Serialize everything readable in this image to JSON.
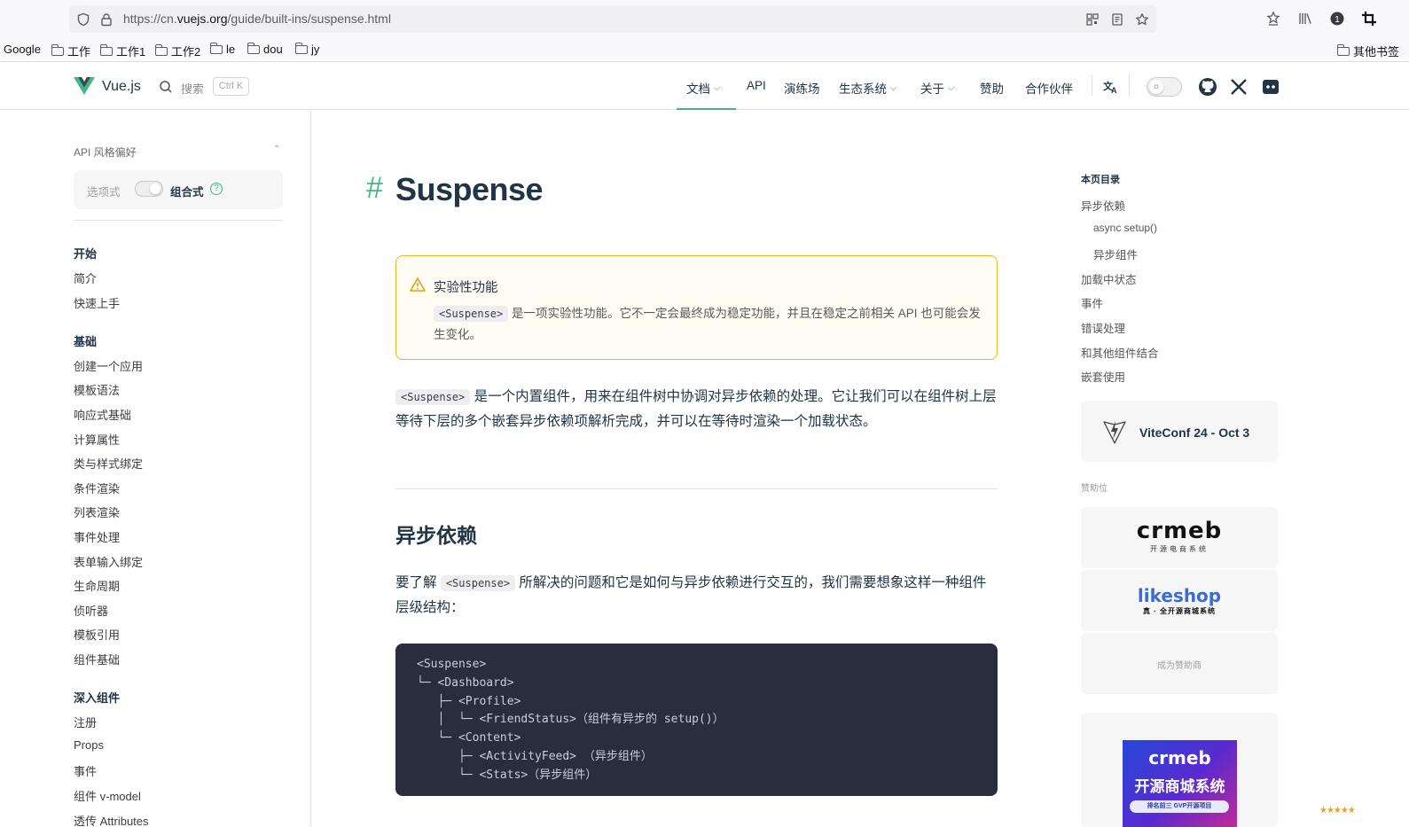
{
  "browser": {
    "url_prefix": "https://cn.",
    "url_domain": "vuejs.org",
    "url_path": "/guide/built-ins/suspense.html",
    "bookmarks": [
      "Google",
      "工作",
      "工作1",
      "工作2",
      "le",
      "dou",
      "jy"
    ],
    "other_bookmarks": "其他书签",
    "badge_count": "1"
  },
  "header": {
    "logo_text": "Vue.js",
    "search_label": "搜索",
    "search_shortcut": "Ctrl K",
    "nav": [
      {
        "label": "文档",
        "dropdown": true
      },
      {
        "label": "API"
      },
      {
        "label": "演练场"
      },
      {
        "label": "生态系统",
        "dropdown": true
      },
      {
        "label": "关于",
        "dropdown": true
      },
      {
        "label": "赞助"
      },
      {
        "label": "合作伙伴"
      }
    ],
    "accent_color": "#42b883"
  },
  "sidebar": {
    "api_pref_title": "API 风格偏好",
    "option_api": "选项式",
    "composition_api": "组合式",
    "groups": [
      {
        "title": "开始",
        "items": [
          "简介",
          "快速上手"
        ]
      },
      {
        "title": "基础",
        "items": [
          "创建一个应用",
          "模板语法",
          "响应式基础",
          "计算属性",
          "类与样式绑定",
          "条件渲染",
          "列表渲染",
          "事件处理",
          "表单输入绑定",
          "生命周期",
          "侦听器",
          "模板引用",
          "组件基础"
        ]
      },
      {
        "title": "深入组件",
        "items": [
          "注册",
          "Props",
          "事件",
          "组件 v-model",
          "透传 Attributes"
        ]
      }
    ]
  },
  "main": {
    "title": "Suspense",
    "hash": "#",
    "warning": {
      "title": "实验性功能",
      "code": "<Suspense>",
      "text": "是一项实验性功能。它不一定会最终成为稳定功能，并且在稳定之前相关 API 也可能会发生变化。"
    },
    "intro_code": "<Suspense>",
    "intro_text": "是一个内置组件，用来在组件树中协调对异步依赖的处理。它让我们可以在组件树上层等待下层的多个嵌套异步依赖项解析完成，并可以在等待时渲染一个加载状态。",
    "section_title": "异步依赖",
    "section_text_before": "要了解",
    "section_code": "<Suspense>",
    "section_text_after": "所解决的问题和它是如何与异步依赖进行交互的，我们需要想象这样一种组件层级结构：",
    "code_lines": [
      "<Suspense>",
      "└─ <Dashboard>",
      "   ├─ <Profile>",
      "   │  └─ <FriendStatus>（组件有异步的 setup()）",
      "   └─ <Content>",
      "      ├─ <ActivityFeed> （异步组件）",
      "      └─ <Stats>（异步组件）"
    ]
  },
  "aside": {
    "toc_title": "本页目录",
    "toc": [
      {
        "label": "异步依赖",
        "level": 1
      },
      {
        "label": "async setup()",
        "level": 2
      },
      {
        "label": "异步组件",
        "level": 2
      },
      {
        "label": "加载中状态",
        "level": 1
      },
      {
        "label": "事件",
        "level": 1
      },
      {
        "label": "错误处理",
        "level": 1
      },
      {
        "label": "和其他组件结合",
        "level": 1
      },
      {
        "label": "嵌套使用",
        "level": 1
      }
    ],
    "viteconf": "ViteConf 24 - Oct 3",
    "sponsor_label": "赞助位",
    "sponsor1_name": "crmeb",
    "sponsor1_sub": "开源电商系统",
    "sponsor2_name": "likeshop",
    "sponsor2_sub": "真 · 全开源商城系统",
    "become_sponsor": "成为赞助商",
    "ad_title": "crmeb",
    "ad_subtitle": "开源商城系统",
    "ad_tag": "排名前三 GVP开源项目"
  }
}
